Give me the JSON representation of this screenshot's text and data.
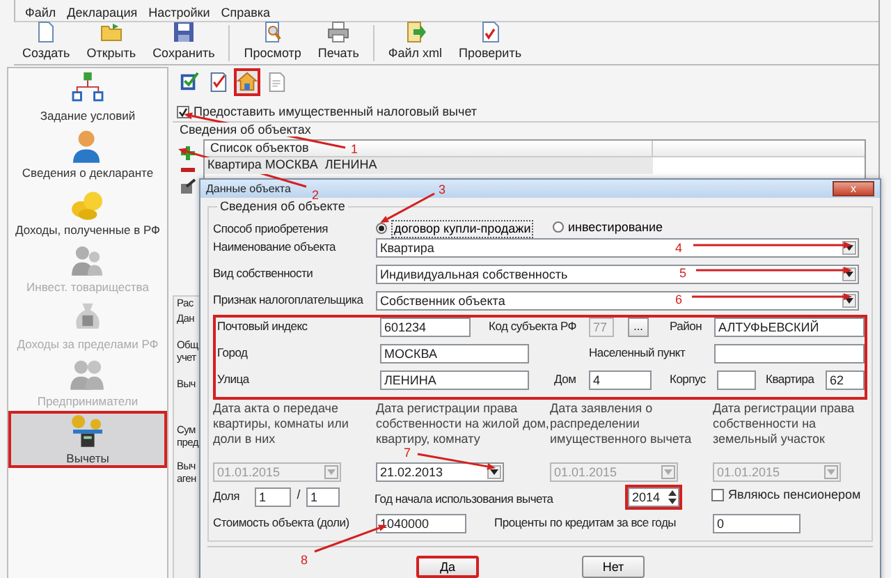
{
  "menu": [
    "Файл",
    "Декларация",
    "Настройки",
    "Справка"
  ],
  "toolbar": [
    {
      "label": "Создать",
      "kind": "new"
    },
    {
      "label": "Открыть",
      "kind": "open"
    },
    {
      "label": "Сохранить",
      "kind": "save"
    },
    {
      "label": "Просмотр",
      "kind": "preview"
    },
    {
      "label": "Печать",
      "kind": "print"
    },
    {
      "label": "Файл xml",
      "kind": "xml"
    },
    {
      "label": "Проверить",
      "kind": "check"
    }
  ],
  "sidebar": [
    {
      "label": "Задание условий",
      "kind": "conditions",
      "disabled": false,
      "selected": false
    },
    {
      "label": "Сведения о декларанте",
      "kind": "declarant",
      "disabled": false,
      "selected": false
    },
    {
      "label": "Доходы, полученные в РФ",
      "kind": "income",
      "disabled": false,
      "selected": false
    },
    {
      "label": "Инвест. товарищества",
      "kind": "invest",
      "disabled": true,
      "selected": false
    },
    {
      "label": "Доходы за пределами РФ",
      "kind": "abroad",
      "disabled": true,
      "selected": false
    },
    {
      "label": "Предприниматели",
      "kind": "business",
      "disabled": true,
      "selected": false
    },
    {
      "label": "Вычеты",
      "kind": "deductions",
      "disabled": false,
      "selected": true
    }
  ],
  "icon_tabs": [
    {
      "kind": "form",
      "selected": false
    },
    {
      "kind": "check",
      "selected": false
    },
    {
      "kind": "house",
      "selected": true
    },
    {
      "kind": "document",
      "selected": false
    }
  ],
  "deduction_checkbox": {
    "label": "Предоставить имущественный налоговый вычет",
    "checked": true
  },
  "objects": {
    "title": "Сведения об объектах",
    "list_header": "Список объектов",
    "rows": [
      "Квартира МОСКВА  ЛЕНИНА"
    ]
  },
  "background_labels": [
    "Рас",
    "Дан",
    "Общ",
    "учет",
    "Выч",
    "Сум",
    "пред",
    "Выч",
    "аген"
  ],
  "dialog": {
    "title": "Данные объекта",
    "group_title": "Сведения об объекте",
    "acquisition": {
      "label": "Способ приобретения",
      "options": [
        {
          "label": "договор купли-продажи",
          "selected": true
        },
        {
          "label": "инвестирование",
          "selected": false
        }
      ]
    },
    "selects": [
      {
        "label": "Наименование объекта",
        "value": "Квартира"
      },
      {
        "label": "Вид собственности",
        "value": "Индивидуальная собственность"
      },
      {
        "label": "Признак налогоплательщика",
        "value": "Собственник объекта"
      }
    ],
    "close_label": "x",
    "address": {
      "highlighted": true,
      "items": [
        {
          "kind": "label",
          "text": "Почтовый индекс"
        },
        {
          "kind": "field",
          "value": "601234",
          "disabled": false
        },
        {
          "kind": "label",
          "text": "Код субъекта РФ"
        },
        {
          "kind": "field",
          "value": "77",
          "disabled": true
        },
        {
          "kind": "button",
          "text": "..."
        },
        {
          "kind": "label",
          "text": "Район"
        },
        {
          "kind": "field",
          "value": "АЛТУФЬЕВСКИЙ",
          "disabled": false
        },
        {
          "kind": "label",
          "text": "Город"
        },
        {
          "kind": "field",
          "value": "МОСКВА",
          "disabled": false
        },
        {
          "kind": "label",
          "text": "Населенный пункт"
        },
        {
          "kind": "field",
          "disabled": false
        },
        {
          "kind": "label",
          "text": "Улица"
        },
        {
          "kind": "field",
          "value": "ЛЕНИНА",
          "disabled": false
        },
        {
          "kind": "label",
          "text": "Дом"
        },
        {
          "kind": "field",
          "value": "4",
          "disabled": false
        },
        {
          "kind": "label",
          "text": "Корпус"
        },
        {
          "kind": "field",
          "disabled": false
        },
        {
          "kind": "label",
          "text": "Квартира"
        },
        {
          "kind": "field",
          "value": "62",
          "disabled": false
        }
      ]
    },
    "dates": [
      {
        "label": "Дата акта о передаче квартиры, комнаты или доли в них",
        "value": "01.01.2015",
        "disabled": true
      },
      {
        "label": "Дата регистрации права собственности на жилой дом, квартиру, комнату",
        "value": "21.02.2013",
        "disabled": false
      },
      {
        "label": "Дата заявления о распределении имущественного вычета",
        "value": "01.01.2015",
        "disabled": true
      },
      {
        "label": "Дата регистрации права собственности на земельный участок",
        "value": "01.01.2015",
        "disabled": true
      }
    ],
    "share": {
      "label": "Доля",
      "numerator": "1",
      "separator": "/",
      "denominator": "1"
    },
    "start_year": {
      "label": "Год начала использования вычета",
      "value": "2014",
      "highlighted": true
    },
    "pensioner": {
      "label": "Являюсь пенсионером",
      "checked": false
    },
    "cost": {
      "label": "Стоимость объекта (доли)",
      "value": "1040000"
    },
    "interest": {
      "label": "Проценты по кредитам за все годы",
      "value": "0"
    },
    "buttons": [
      {
        "label": "Да",
        "highlighted": true
      },
      {
        "label": "Нет",
        "highlighted": false
      }
    ]
  },
  "annotations": [
    "1",
    "2",
    "3",
    "4",
    "5",
    "6",
    "7",
    "8"
  ]
}
